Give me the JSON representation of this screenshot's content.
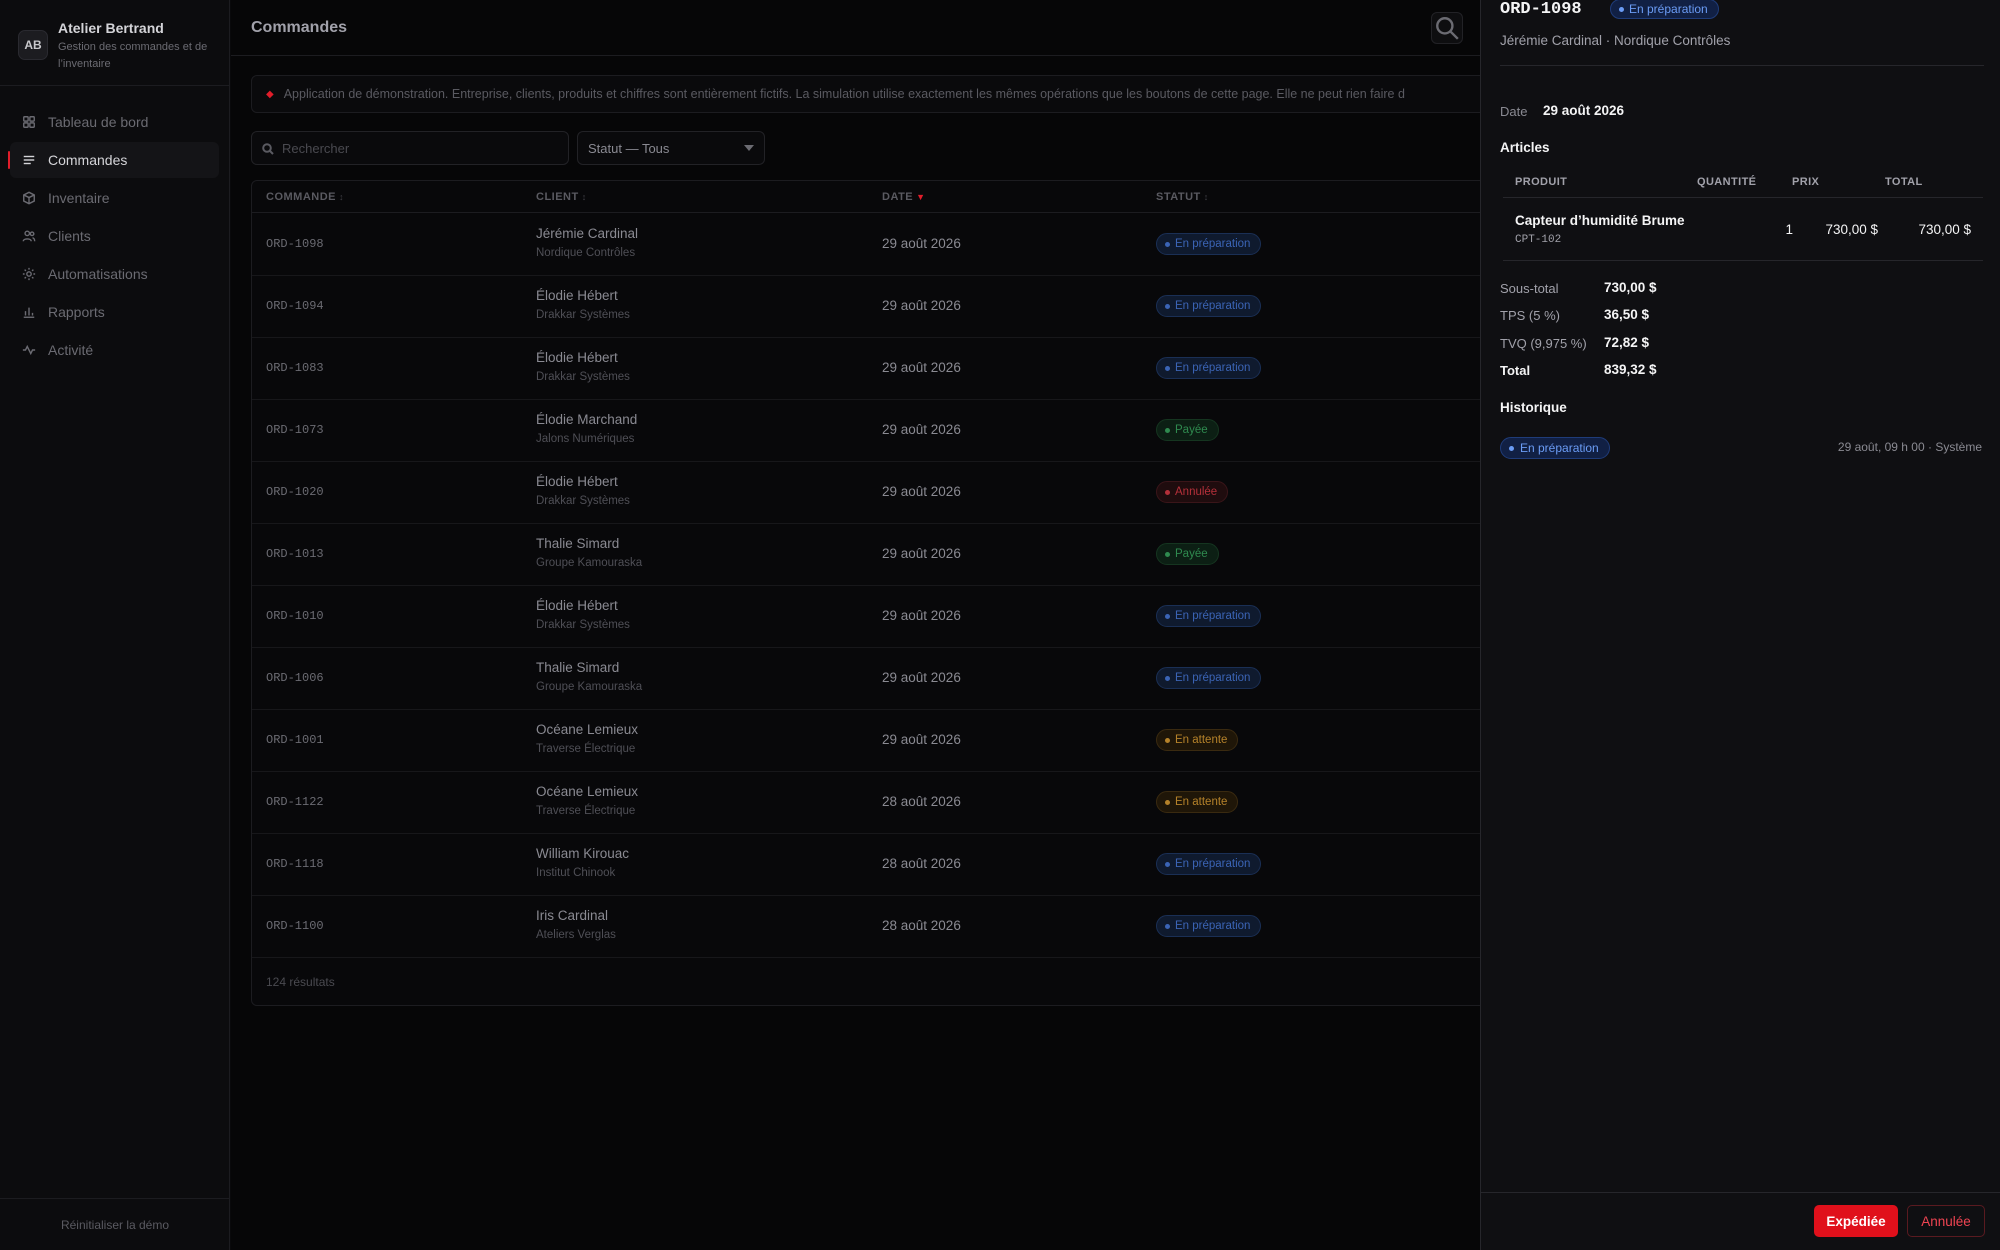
{
  "brand": {
    "initials": "AB",
    "name": "Atelier Bertrand",
    "subtitle": "Gestion des commandes et de l’inventaire"
  },
  "nav": [
    {
      "label": "Tableau de bord",
      "icon": "grid-icon"
    },
    {
      "label": "Commandes",
      "icon": "list-icon",
      "active": true
    },
    {
      "label": "Inventaire",
      "icon": "box-icon"
    },
    {
      "label": "Clients",
      "icon": "users-icon"
    },
    {
      "label": "Automatisations",
      "icon": "gear-icon"
    },
    {
      "label": "Rapports",
      "icon": "bar-chart-icon"
    },
    {
      "label": "Activité",
      "icon": "activity-icon"
    }
  ],
  "sidebar_footer": "Réinitialiser la démo",
  "page": {
    "title": "Commandes"
  },
  "notice": "Application de démonstration. Entreprise, clients, produits et chiffres sont entièrement fictifs. La simulation utilise exactement les mêmes opérations que les boutons de cette page. Elle ne peut rien faire d",
  "filters": {
    "search_placeholder": "Rechercher",
    "status_value": "Statut — Tous"
  },
  "table": {
    "headers": {
      "order": "COMMANDE",
      "client": "CLIENT",
      "date": "DATE",
      "status": "STATUT"
    },
    "rows": [
      {
        "id": "ORD-1098",
        "name": "Jérémie Cardinal",
        "company": "Nordique Contrôles",
        "date": "29 août 2026",
        "status": "En préparation",
        "kind": "prep"
      },
      {
        "id": "ORD-1094",
        "name": "Élodie Hébert",
        "company": "Drakkar Systèmes",
        "date": "29 août 2026",
        "status": "En préparation",
        "kind": "prep"
      },
      {
        "id": "ORD-1083",
        "name": "Élodie Hébert",
        "company": "Drakkar Systèmes",
        "date": "29 août 2026",
        "status": "En préparation",
        "kind": "prep"
      },
      {
        "id": "ORD-1073",
        "name": "Élodie Marchand",
        "company": "Jalons Numériques",
        "date": "29 août 2026",
        "status": "Payée",
        "kind": "paid"
      },
      {
        "id": "ORD-1020",
        "name": "Élodie Hébert",
        "company": "Drakkar Systèmes",
        "date": "29 août 2026",
        "status": "Annulée",
        "kind": "cancel"
      },
      {
        "id": "ORD-1013",
        "name": "Thalie Simard",
        "company": "Groupe Kamouraska",
        "date": "29 août 2026",
        "status": "Payée",
        "kind": "paid"
      },
      {
        "id": "ORD-1010",
        "name": "Élodie Hébert",
        "company": "Drakkar Systèmes",
        "date": "29 août 2026",
        "status": "En préparation",
        "kind": "prep"
      },
      {
        "id": "ORD-1006",
        "name": "Thalie Simard",
        "company": "Groupe Kamouraska",
        "date": "29 août 2026",
        "status": "En préparation",
        "kind": "prep"
      },
      {
        "id": "ORD-1001",
        "name": "Océane Lemieux",
        "company": "Traverse Électrique",
        "date": "29 août 2026",
        "status": "En attente",
        "kind": "wait"
      },
      {
        "id": "ORD-1122",
        "name": "Océane Lemieux",
        "company": "Traverse Électrique",
        "date": "28 août 2026",
        "status": "En attente",
        "kind": "wait"
      },
      {
        "id": "ORD-1118",
        "name": "William Kirouac",
        "company": "Institut Chinook",
        "date": "28 août 2026",
        "status": "En préparation",
        "kind": "prep"
      },
      {
        "id": "ORD-1100",
        "name": "Iris Cardinal",
        "company": "Ateliers Verglas",
        "date": "28 août 2026",
        "status": "En préparation",
        "kind": "prep"
      }
    ],
    "result_count": "124 résultats"
  },
  "detail": {
    "order_id": "ORD-1098",
    "status": "En préparation",
    "client_line": "Jérémie Cardinal · Nordique Contrôles",
    "date_label": "Date",
    "date_value": "29 août 2026",
    "articles_title": "Articles",
    "items_headers": {
      "product": "PRODUIT",
      "qty": "QUANTITÉ",
      "price": "PRIX",
      "total": "TOTAL"
    },
    "item": {
      "name": "Capteur d’humidité Brume",
      "sku": "CPT-102",
      "qty": "1",
      "price": "730,00 $",
      "total": "730,00 $"
    },
    "totals": {
      "subtotal_label": "Sous-total",
      "subtotal": "730,00 $",
      "tps_label": "TPS (5 %)",
      "tps": "36,50 $",
      "tvq_label": "TVQ (9,975 %)",
      "tvq": "72,82 $",
      "total_label": "Total",
      "total": "839,32 $"
    },
    "history_title": "Historique",
    "history": {
      "status": "En préparation",
      "meta": "29 août, 09 h 00 · Système"
    },
    "actions": {
      "shipped": "Expédiée",
      "cancel": "Annulée"
    }
  }
}
